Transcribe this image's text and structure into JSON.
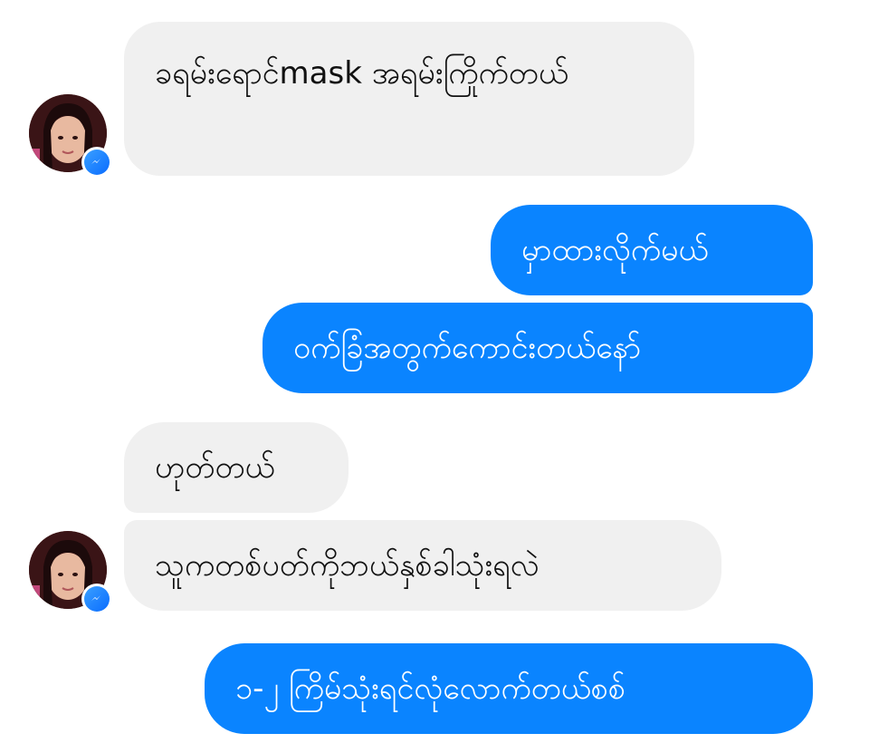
{
  "conversation": {
    "messages": [
      {
        "sender": "contact",
        "text": "ခရမ်းရောင်mask အရမ်းကြိုက်တယ်"
      },
      {
        "sender": "me",
        "text": "မှာထားလိုက်မယ်"
      },
      {
        "sender": "me",
        "text": "ဝက်ခြံအတွက်ကောင်းတယ်နော်"
      },
      {
        "sender": "contact",
        "text": "ဟုတ်တယ်"
      },
      {
        "sender": "contact",
        "text": "သူကတစ်ပတ်ကိုဘယ်နှစ်ခါသုံးရလဲ"
      },
      {
        "sender": "me",
        "text": "၁-၂ ကြိမ်သုံးရင်လုံလောက်တယ်စစ်"
      }
    ]
  },
  "contact": {
    "avatar_icon": "profile-photo",
    "badge_icon": "messenger-icon"
  },
  "colors": {
    "incoming_bubble": "#f0f0f0",
    "outgoing_bubble": "#0a84ff",
    "outgoing_text": "#ffffff",
    "incoming_text": "#111111"
  }
}
